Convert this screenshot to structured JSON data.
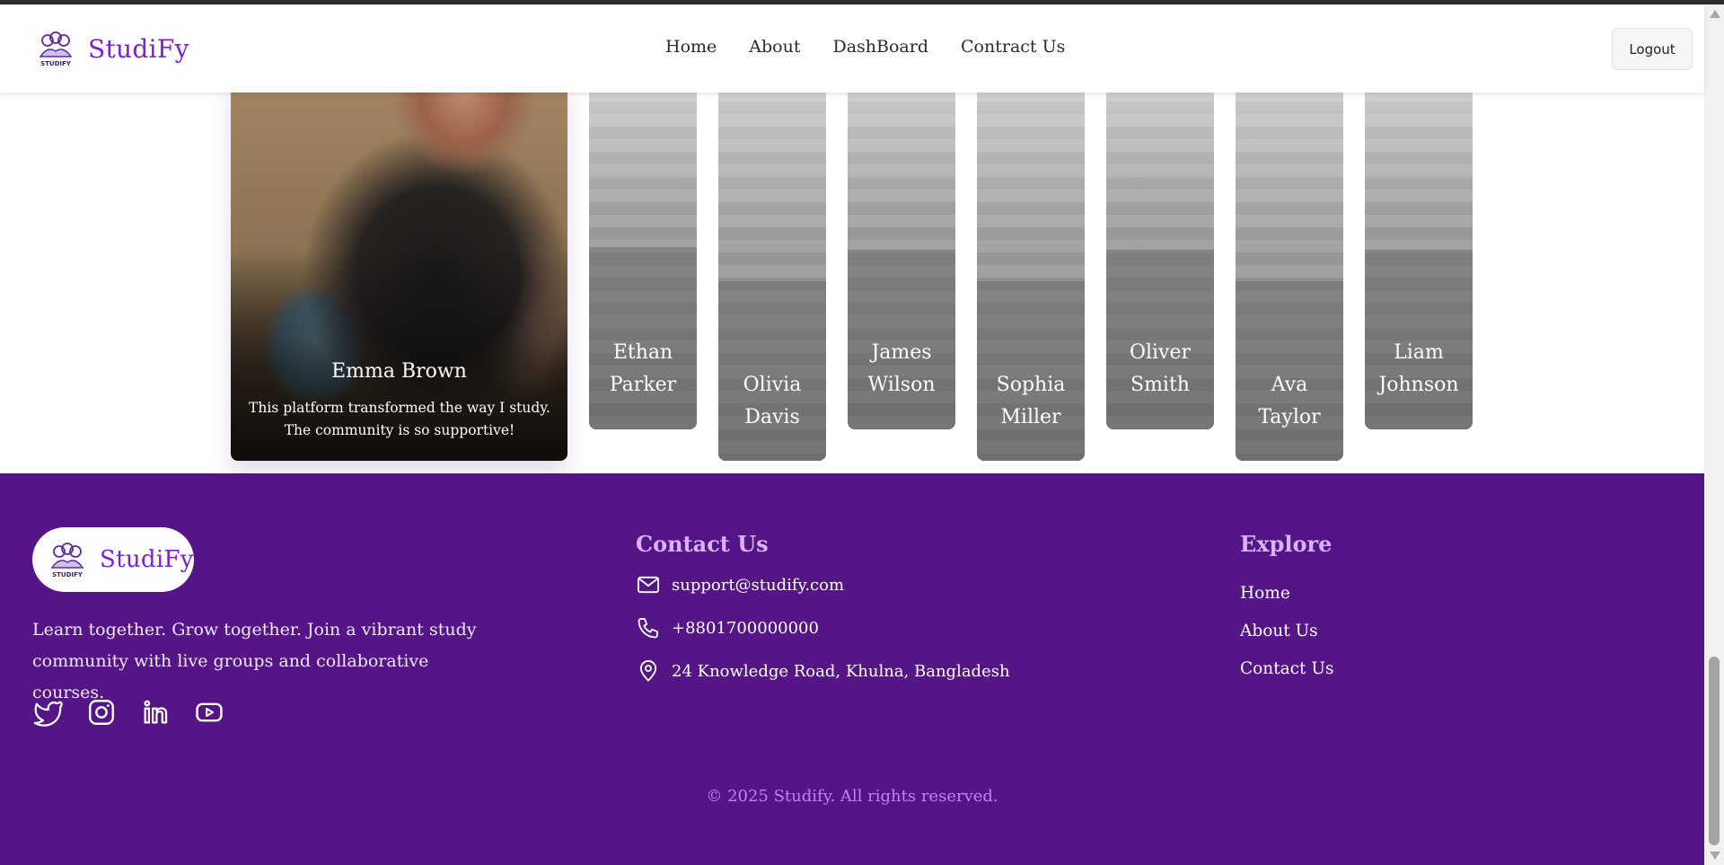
{
  "header": {
    "brand": "StudiFy",
    "logo_text": "STUDIFY",
    "nav": [
      "Home",
      "About",
      "DashBoard",
      "Contract Us"
    ],
    "logout": "Logout"
  },
  "testimonials": {
    "featured": {
      "name": "Emma Brown",
      "quote": "This platform transformed the way I study. The community is so supportive!"
    },
    "others": [
      {
        "first": "Ethan",
        "last": "Parker"
      },
      {
        "first": "Olivia",
        "last": "Davis"
      },
      {
        "first": "James",
        "last": "Wilson"
      },
      {
        "first": "Sophia",
        "last": "Miller"
      },
      {
        "first": "Oliver",
        "last": "Smith"
      },
      {
        "first": "Ava",
        "last": "Taylor"
      },
      {
        "first": "Liam",
        "last": "Johnson"
      }
    ]
  },
  "footer": {
    "brand": "StudiFy",
    "logo_text": "STUDIFY",
    "description": "Learn together. Grow together. Join a vibrant study community with live groups and collaborative courses.",
    "socials": [
      "twitter-icon",
      "instagram-icon",
      "linkedin-icon",
      "youtube-icon"
    ],
    "contact_title": "Contact Us",
    "email": "support@studify.com",
    "phone": "+8801700000000",
    "address": "24 Knowledge Road, Khulna, Bangladesh",
    "explore_title": "Explore",
    "explore_links": [
      "Home",
      "About Us",
      "Contact Us"
    ],
    "copyright": "© 2025 Studify. All rights reserved."
  },
  "colors": {
    "brand": "#7b22d6",
    "footer_bg": "#561587",
    "footer_heading": "#d7b3ff",
    "copyright": "#c77cff"
  }
}
